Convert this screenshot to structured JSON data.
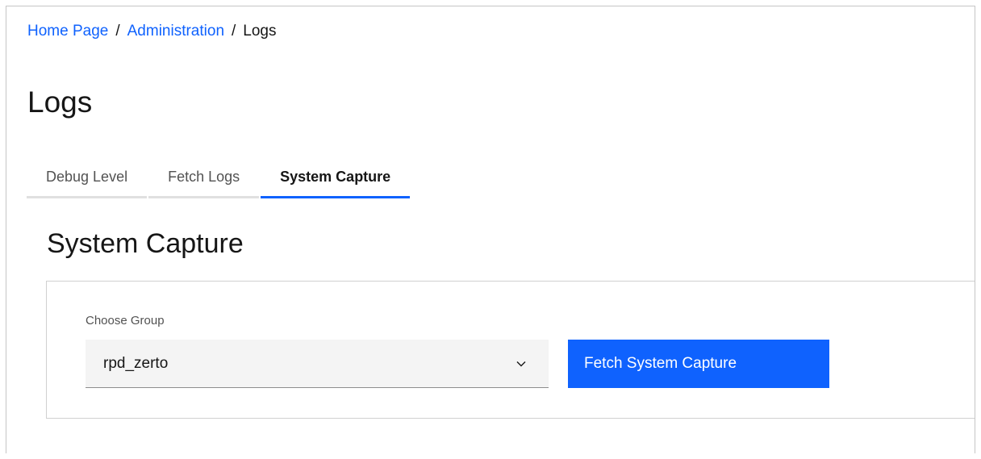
{
  "breadcrumb": {
    "items": [
      {
        "label": "Home Page"
      },
      {
        "label": "Administration"
      },
      {
        "label": "Logs"
      }
    ],
    "separator": "/"
  },
  "page": {
    "title": "Logs"
  },
  "tabs": [
    {
      "label": "Debug Level",
      "active": false
    },
    {
      "label": "Fetch Logs",
      "active": false
    },
    {
      "label": "System Capture",
      "active": true
    }
  ],
  "section": {
    "title": "System Capture",
    "group_label": "Choose Group",
    "group_value": "rpd_zerto",
    "fetch_button_label": "Fetch System Capture"
  },
  "icons": {
    "dropdown": "chevron-down-icon"
  },
  "colors": {
    "link": "#0f62fe",
    "primary_button": "#0f62fe",
    "active_tab_underline": "#0f62fe",
    "select_background": "#f4f4f4"
  }
}
